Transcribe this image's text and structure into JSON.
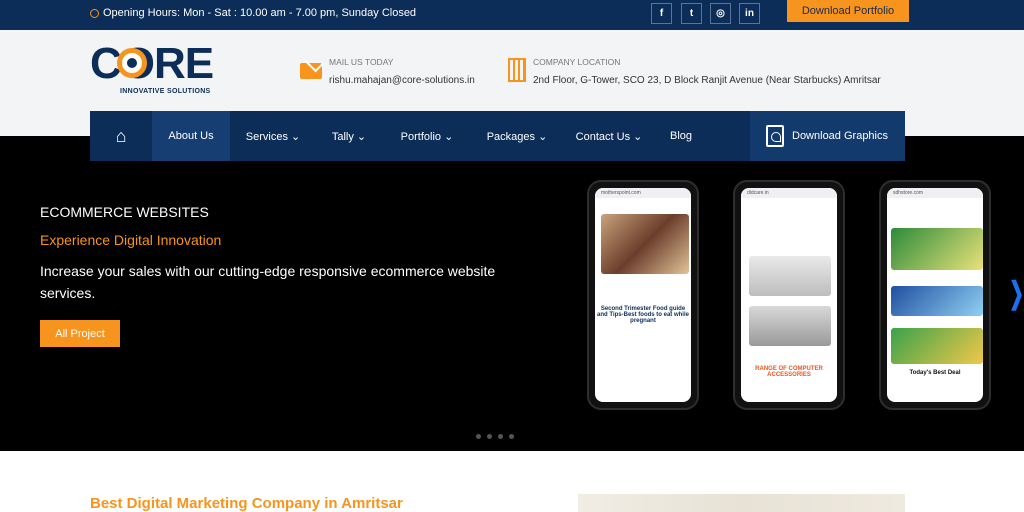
{
  "topbar": {
    "hours": "Opening Hours: Mon - Sat : 10.00 am - 7.00 pm, Sunday Closed",
    "social": [
      {
        "icon": "facebook-icon",
        "glyph": "f"
      },
      {
        "icon": "twitter-icon",
        "glyph": "t"
      },
      {
        "icon": "instagram-icon",
        "glyph": "◎"
      },
      {
        "icon": "linkedin-icon",
        "glyph": "in"
      }
    ],
    "download_portfolio": "Download Portfolio"
  },
  "header": {
    "logo_text": "CORE",
    "logo_sub": "INNOVATIVE SOLUTIONS",
    "mail_label": "MAIL US TODAY",
    "mail_value": "rishu.mahajan@core-solutions.in",
    "location_label": "COMPANY LOCATION",
    "location_value": "2nd Floor, G-Tower, SCO 23, D Block Ranjit Avenue (Near Starbucks) Amritsar"
  },
  "nav": {
    "items": [
      {
        "label": "About Us"
      },
      {
        "label": "Services ⌄"
      },
      {
        "label": "Tally ⌄"
      },
      {
        "label": "Portfolio ⌄"
      },
      {
        "label": "Packages ⌄"
      },
      {
        "label": "Contact Us ⌄"
      },
      {
        "label": "Blog"
      }
    ],
    "download_graphics": "Download Graphics"
  },
  "hero": {
    "eyebrow": "ECOMMERCE WEBSITES",
    "tagline": "Experience Digital Innovation",
    "description": "Increase your sales with our cutting-edge responsive ecommerce website services.",
    "cta": "All Project",
    "phones": [
      {
        "url": "motherspoint.com",
        "title": "Second Trimester Food guide and Tips-Best foods to eat while pregnant"
      },
      {
        "url": "didcare.in",
        "title": "RANGE OF COMPUTER ACCESSORIES"
      },
      {
        "url": "sdhstore.com",
        "title": "Today's Best Deal"
      }
    ]
  },
  "section": {
    "heading": "Best Digital Marketing Company in Amritsar"
  },
  "colors": {
    "navy": "#0c2d57",
    "orange": "#f7941d"
  }
}
